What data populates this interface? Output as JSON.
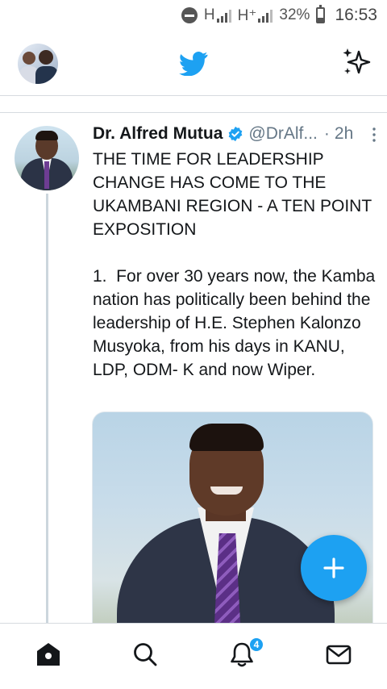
{
  "status_bar": {
    "network_1": "H",
    "network_2": "H⁺",
    "battery_percent": "32%",
    "battery_level": 0.32,
    "time": "16:53",
    "icons": [
      "do-not-disturb-icon",
      "signal-icon",
      "signal-icon",
      "battery-icon"
    ]
  },
  "top_bar": {
    "left": "profile-avatar",
    "center": "twitter-bird-icon",
    "right": "sparkle-icon",
    "brand_color": "#1DA1F2"
  },
  "tweet": {
    "author_name": "Dr. Alfred Mutua",
    "verified": true,
    "handle": "@DrAlf...",
    "separator": "·",
    "time_ago": "2h",
    "text": "THE TIME FOR LEADERSHIP CHANGE HAS COME TO THE UKAMBANI REGION - A TEN POINT EXPOSITION\n\n1.  For over 30 years now, the Kamba nation has politically been behind the leadership of H.E. Stephen Kalonzo Musyoka, from his days in KANU, LDP, ODM- K and now Wiper.",
    "media": "photo"
  },
  "fab": {
    "icon": "plus-icon",
    "color": "#1DA1F2"
  },
  "bottom_nav": {
    "items": [
      {
        "icon": "home-icon",
        "active": true
      },
      {
        "icon": "search-icon",
        "active": false
      },
      {
        "icon": "bell-icon",
        "active": false
      },
      {
        "icon": "mail-icon",
        "active": false
      }
    ],
    "notification_count": "4"
  }
}
